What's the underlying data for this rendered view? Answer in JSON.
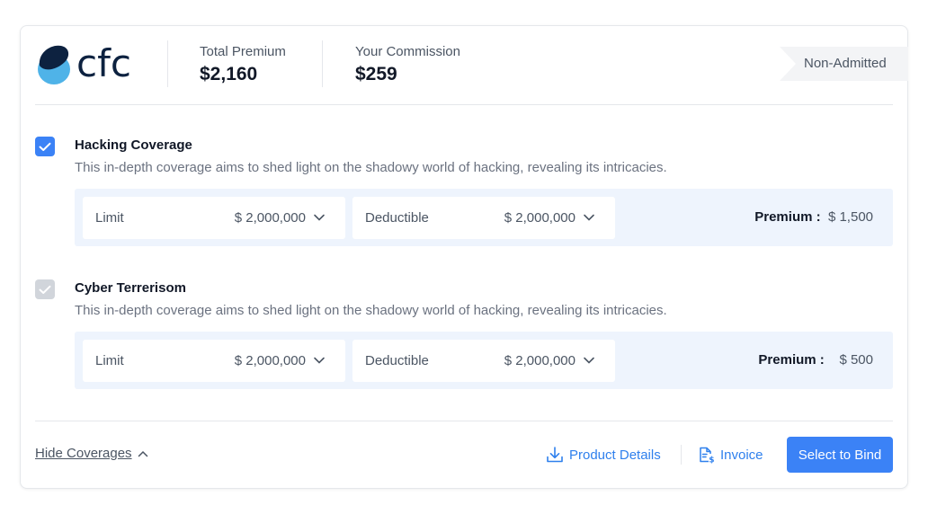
{
  "brand": {
    "logo_text": "cfc"
  },
  "header": {
    "total_premium_label": "Total Premium",
    "total_premium_value": "$2,160",
    "commission_label": "Your Commission",
    "commission_value": "$259",
    "admission_tag": "Non-Admitted"
  },
  "coverages": [
    {
      "title": "Hacking Coverage",
      "checked": true,
      "description": "This in-depth coverage aims to shed light on the shadowy world of hacking, revealing its intricacies.",
      "limit_label": "Limit",
      "limit_value": "$ 2,000,000",
      "deductible_label": "Deductible",
      "deductible_value": "$ 2,000,000",
      "premium_label": "Premium :",
      "premium_value": "$ 1,500"
    },
    {
      "title": "Cyber Terrerisom",
      "checked": false,
      "description": "This in-depth coverage aims to shed light on the shadowy world of hacking, revealing its intricacies.",
      "limit_label": "Limit",
      "limit_value": "$ 2,000,000",
      "deductible_label": "Deductible",
      "deductible_value": "$ 2,000,000",
      "premium_label": "Premium :",
      "premium_value": "$ 500"
    }
  ],
  "footer": {
    "hide_coverages": "Hide Coverages",
    "product_details": "Product Details",
    "invoice": "Invoice",
    "select_to_bind": "Select to Bind"
  },
  "colors": {
    "accent": "#3b82f6",
    "panel_bg": "#eef4fd",
    "logo_dark": "#0d2240",
    "logo_light": "#4fb3e8"
  }
}
